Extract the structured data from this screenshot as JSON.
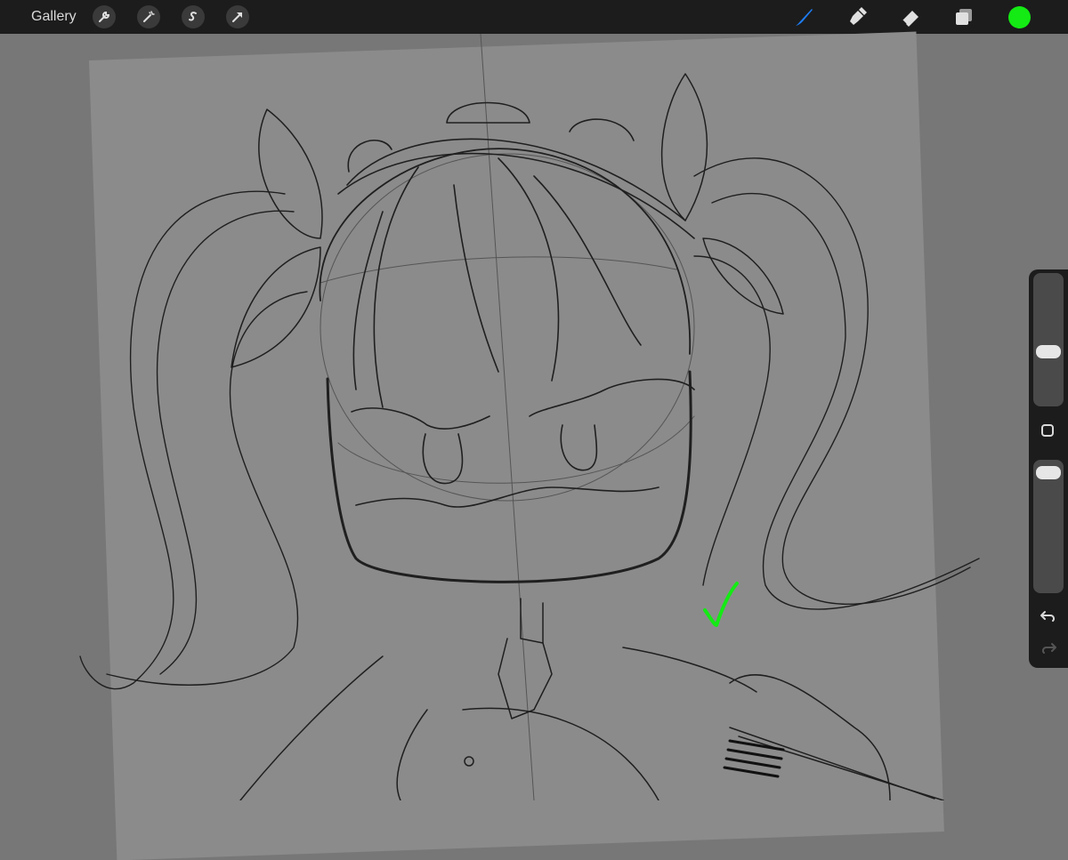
{
  "topbar": {
    "gallery_label": "Gallery",
    "left_tools": [
      {
        "name": "actions",
        "icon": "wrench-icon"
      },
      {
        "name": "adjustments",
        "icon": "magic-wand-icon"
      },
      {
        "name": "selection",
        "icon": "selection-s-icon"
      },
      {
        "name": "transform",
        "icon": "arrow-cursor-icon"
      }
    ],
    "right_tools": [
      {
        "name": "brush",
        "icon": "brush-icon",
        "active": true
      },
      {
        "name": "smudge",
        "icon": "smudge-icon",
        "active": false
      },
      {
        "name": "eraser",
        "icon": "eraser-icon",
        "active": false
      },
      {
        "name": "layers",
        "icon": "layers-icon",
        "active": false
      }
    ],
    "current_color": "#14ea14",
    "active_tool_color": "#1e7cf2"
  },
  "sidebar": {
    "brush_size_level": 0.6,
    "opacity_level": 0.05,
    "modify_icon": "square-icon",
    "undo_icon": "undo-arrow-icon",
    "redo_icon": "redo-arrow-icon"
  },
  "canvas": {
    "background_color": "#777777",
    "paper_color": "#8b8b8b",
    "sketch_color": "#1f1f1f",
    "checkmark_color": "#14ea14"
  }
}
